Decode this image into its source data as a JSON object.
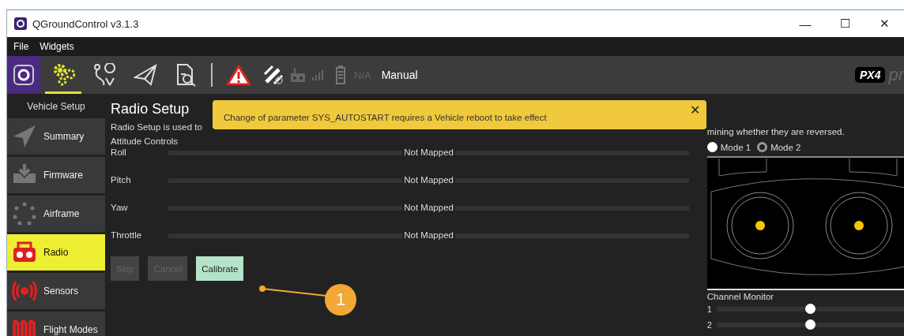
{
  "window": {
    "title": "QGroundControl v3.1.3",
    "controls": [
      "—",
      "☐",
      "✕"
    ]
  },
  "menu": [
    "File",
    "Widgets"
  ],
  "toolbar": {
    "views": [
      {
        "selected": true
      },
      {
        "selected": false
      },
      {
        "selected": false
      },
      {
        "selected": false
      }
    ],
    "battery": "N/A",
    "flight_mode": "Manual",
    "brand": "PX4",
    "brand_tail": "pr"
  },
  "sidebar": {
    "title": "Vehicle Setup",
    "items": [
      {
        "label": "Summary",
        "selected": false
      },
      {
        "label": "Firmware",
        "selected": false
      },
      {
        "label": "Airframe",
        "selected": false
      },
      {
        "label": "Radio",
        "selected": true
      },
      {
        "label": "Sensors",
        "selected": false
      },
      {
        "label": "Flight Modes",
        "selected": false
      }
    ]
  },
  "page": {
    "title": "Radio Setup",
    "description": "Radio Setup is used to",
    "section": "Attitude Controls",
    "controls": [
      {
        "label": "Roll",
        "value": "Not Mapped"
      },
      {
        "label": "Pitch",
        "value": "Not Mapped"
      },
      {
        "label": "Yaw",
        "value": "Not Mapped"
      },
      {
        "label": "Throttle",
        "value": "Not Mapped"
      }
    ],
    "buttons": [
      {
        "label": "Skip",
        "disabled": true
      },
      {
        "label": "Cancel",
        "disabled": true
      },
      {
        "label": "Calibrate",
        "disabled": false
      }
    ]
  },
  "notice": {
    "message": "Change of parameter SYS_AUTOSTART requires a Vehicle reboot to take effect",
    "close": "✕"
  },
  "right": {
    "description": "mining whether they are reversed.",
    "modes": [
      {
        "label": "Mode 1",
        "selected": false
      },
      {
        "label": "Mode 2",
        "selected": true
      }
    ],
    "channel_monitor": {
      "title": "Channel Monitor",
      "channels": [
        {
          "label": "1",
          "level": 0.5
        },
        {
          "label": "2",
          "level": 0.5
        }
      ]
    }
  },
  "annotation": {
    "label": "1"
  }
}
